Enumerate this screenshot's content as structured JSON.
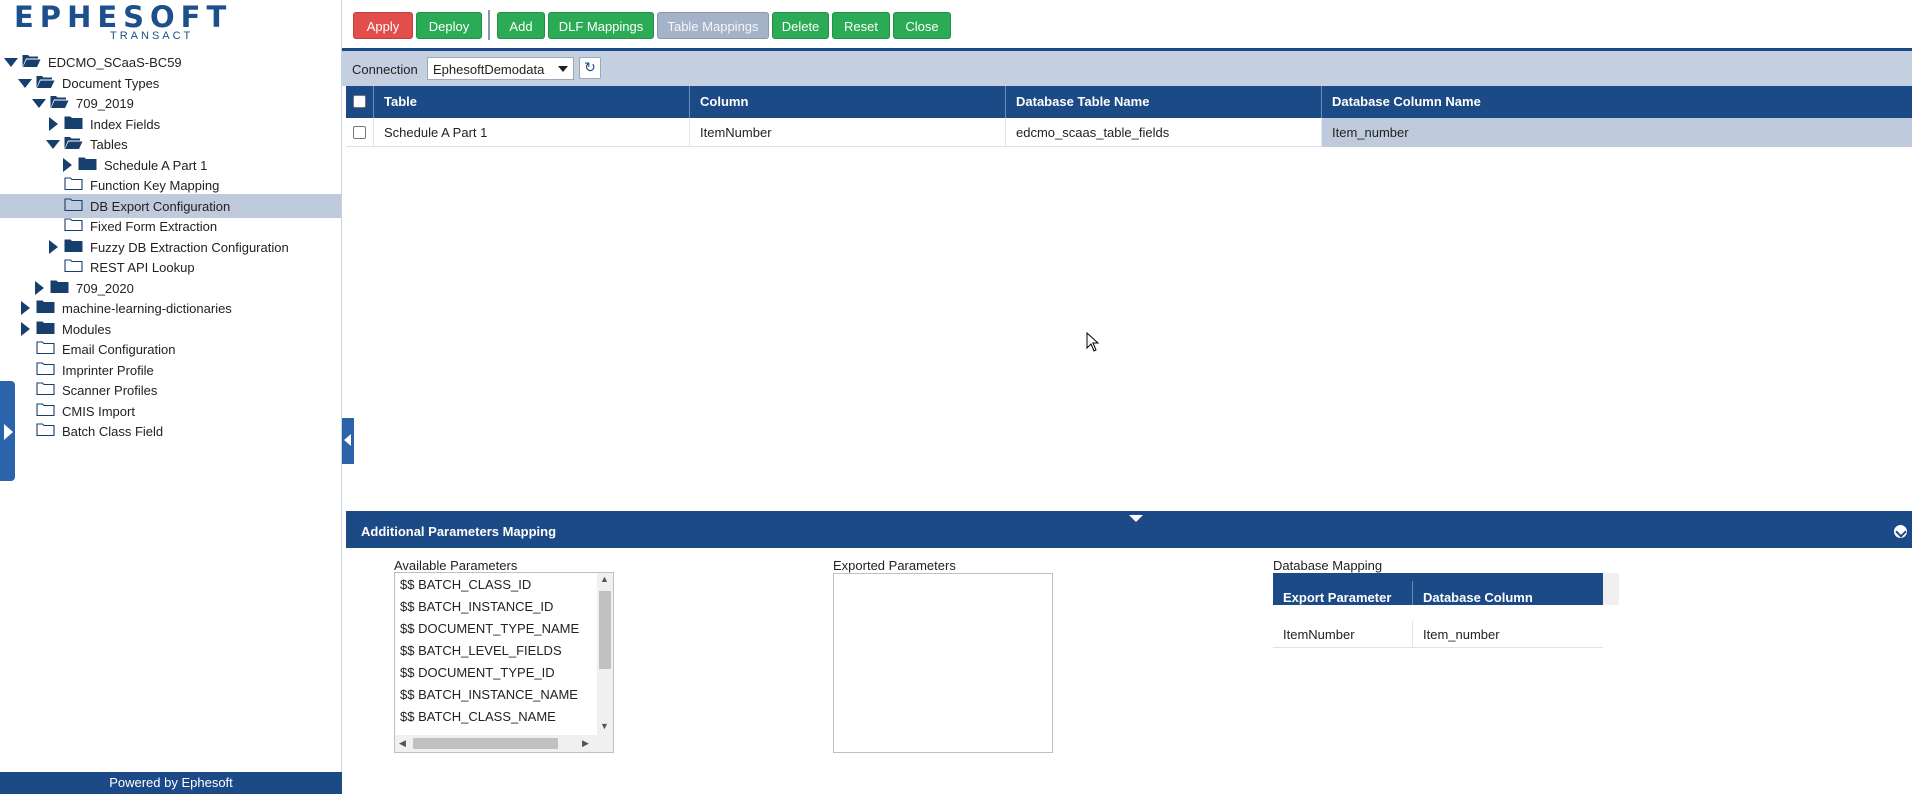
{
  "logo": {
    "text": "EPHESOFT",
    "subtext": "TRANSACT"
  },
  "tree": [
    {
      "label": "EDCMO_SCaaS-BC59",
      "level": 0,
      "arrow": "down",
      "folder": "open"
    },
    {
      "label": "Document Types",
      "level": 1,
      "arrow": "down",
      "folder": "open"
    },
    {
      "label": "709_2019",
      "level": 2,
      "arrow": "down",
      "folder": "open"
    },
    {
      "label": "Index Fields",
      "level": 3,
      "arrow": "right",
      "folder": "closed"
    },
    {
      "label": "Tables",
      "level": 3,
      "arrow": "down",
      "folder": "open"
    },
    {
      "label": "Schedule A Part 1",
      "level": 4,
      "arrow": "right",
      "folder": "closed"
    },
    {
      "label": "Function Key Mapping",
      "level": 3,
      "arrow": "none",
      "folder": "outline"
    },
    {
      "label": "DB Export Configuration",
      "level": 3,
      "arrow": "none",
      "folder": "outline",
      "selected": true
    },
    {
      "label": "Fixed Form Extraction",
      "level": 3,
      "arrow": "none",
      "folder": "outline"
    },
    {
      "label": "Fuzzy DB Extraction Configuration",
      "level": 3,
      "arrow": "right",
      "folder": "closed"
    },
    {
      "label": "REST API Lookup",
      "level": 3,
      "arrow": "none",
      "folder": "outline"
    },
    {
      "label": "709_2020",
      "level": 2,
      "arrow": "right",
      "folder": "closed"
    },
    {
      "label": "machine-learning-dictionaries",
      "level": 1,
      "arrow": "right",
      "folder": "closed"
    },
    {
      "label": "Modules",
      "level": 1,
      "arrow": "right",
      "folder": "closed"
    },
    {
      "label": "Email Configuration",
      "level": 1,
      "arrow": "none",
      "folder": "outline"
    },
    {
      "label": "Imprinter Profile",
      "level": 1,
      "arrow": "none",
      "folder": "outline"
    },
    {
      "label": "Scanner Profiles",
      "level": 1,
      "arrow": "none",
      "folder": "outline"
    },
    {
      "label": "CMIS Import",
      "level": 1,
      "arrow": "none",
      "folder": "outline"
    },
    {
      "label": "Batch Class Field",
      "level": 1,
      "arrow": "none",
      "folder": "outline"
    }
  ],
  "footer": {
    "text": "Powered by Ephesoft"
  },
  "toolbar": {
    "apply": "Apply",
    "deploy": "Deploy",
    "add": "Add",
    "dlf_mappings": "DLF Mappings",
    "table_mappings": "Table Mappings",
    "delete": "Delete",
    "reset": "Reset",
    "close": "Close"
  },
  "connection": {
    "label": "Connection",
    "value": "EphesoftDemodata"
  },
  "grid": {
    "columns": [
      "Table",
      "Column",
      "Database Table Name",
      "Database Column Name"
    ],
    "rows": [
      {
        "table": "Schedule A Part 1",
        "column": "ItemNumber",
        "db_table": "edcmo_scaas_table_fields",
        "db_column": "Item_number"
      }
    ]
  },
  "params": {
    "title": "Additional Parameters Mapping",
    "available_label": "Available Parameters",
    "exported_label": "Exported Parameters",
    "db_mapping_label": "Database Mapping",
    "available": [
      "$$ BATCH_CLASS_ID",
      "$$ BATCH_INSTANCE_ID",
      "$$ DOCUMENT_TYPE_NAME",
      "$$ BATCH_LEVEL_FIELDS",
      "$$ DOCUMENT_TYPE_ID",
      "$$ BATCH_INSTANCE_NAME",
      "$$ BATCH_CLASS_NAME"
    ],
    "db_mapping": {
      "headers": [
        "Export Parameter",
        "Database Column"
      ],
      "rows": [
        {
          "param": "ItemNumber",
          "column": "Item_number"
        }
      ]
    }
  },
  "colors": {
    "brand_blue": "#1b4a86",
    "button_green": "#2bab55",
    "button_red": "#e14e4c",
    "button_disabled": "#a5b3c8",
    "selected_row": "#bfcbdc"
  }
}
